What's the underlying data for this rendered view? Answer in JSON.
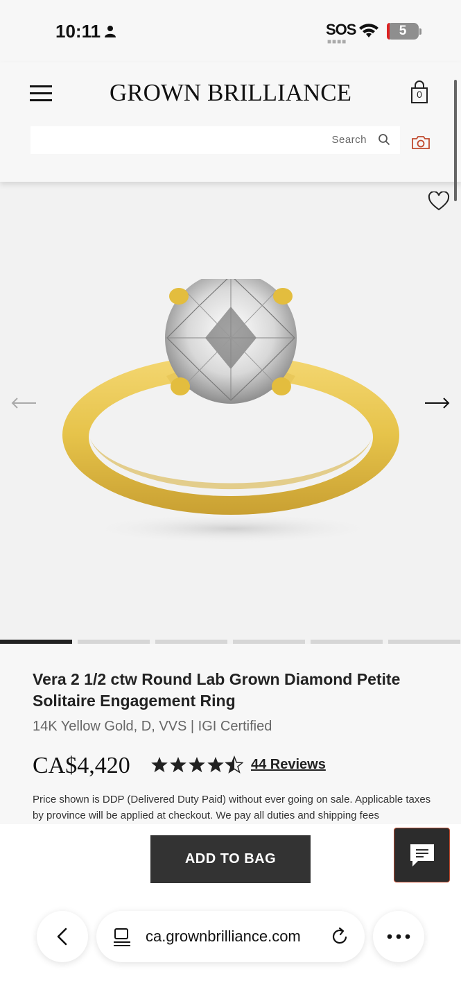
{
  "status_bar": {
    "time": "10:11",
    "sos": "SOS",
    "battery_level": "5",
    "icons": [
      "person-icon",
      "wifi-icon",
      "battery-icon"
    ]
  },
  "header": {
    "brand": "GROWN BRILLIANCE",
    "bag_count": "0",
    "search_placeholder": "Search",
    "icons": [
      "menu-icon",
      "bag-icon",
      "search-icon",
      "camera-icon"
    ]
  },
  "gallery": {
    "slide_count": 6,
    "active_slide": 1,
    "icons": [
      "heart-icon",
      "arrow-left-icon",
      "arrow-right-icon"
    ]
  },
  "product": {
    "title": "Vera 2 1/2 ctw Round Lab Grown Diamond Petite Solitaire Engagement Ring",
    "subtitle": "14K Yellow Gold, D, VVS | IGI Certified",
    "price": "CA$4,420",
    "rating": 4.5,
    "rating_max": 5,
    "reviews_label": "44 Reviews",
    "note": "Price shown is DDP (Delivered Duty Paid) without ever going on sale. Applicable taxes by province will be applied at checkout. We pay all duties and shipping fees"
  },
  "actions": {
    "add_to_bag": "ADD TO BAG"
  },
  "browser": {
    "url": "ca.grownbrilliance.com",
    "icons": [
      "back-icon",
      "tab-icon",
      "reload-icon",
      "more-icon"
    ]
  },
  "colors": {
    "accent_border": "#c04a2e",
    "button_dark": "#333333",
    "gold": "#e6c34a"
  }
}
